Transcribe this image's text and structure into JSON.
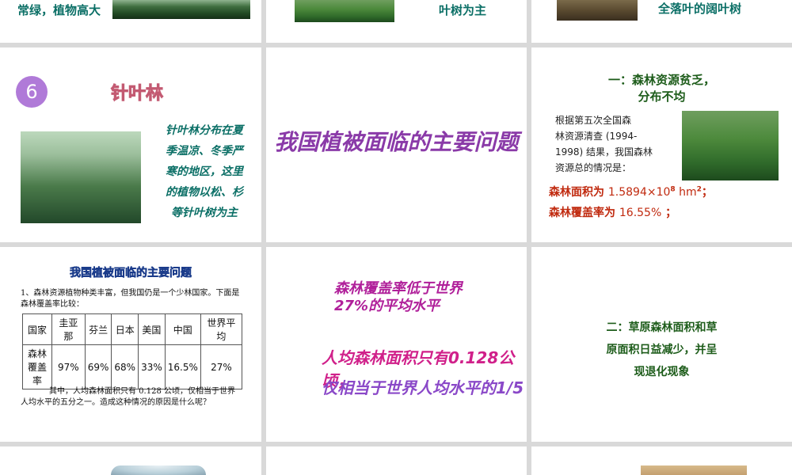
{
  "row0": {
    "left_text": "常绿，植物高大",
    "mid_text": "叶树为主",
    "right_text": "全落叶的阔叶树"
  },
  "slide_conifer": {
    "number": "6",
    "title": "针叶林",
    "body": [
      "针叶林分布在夏",
      "季温凉、冬季严",
      "寒的地区，这里",
      "的植物以松、杉",
      "等针叶树为主"
    ]
  },
  "slide_problem": {
    "heading": "我国植被面临的主要问题"
  },
  "slide_forest_shortage": {
    "heading_line1": "一：森林资源贫乏，",
    "heading_line2": "分布不均",
    "body": [
      "根据第五次全国森",
      "林资源清查 (1994-",
      "1998) 结果，我国森林",
      "资源总的情况是："
    ],
    "area_label": "森林面积为",
    "area_value": "1.5894×10",
    "area_exp": "8",
    "area_unit": " hm",
    "area_unit_exp": "2",
    "area_end": "；",
    "coverage_label": "森林覆盖率为",
    "coverage_value": "16.55%",
    "coverage_end": "；"
  },
  "slide_table": {
    "heading": "我国植被面临的主要问题",
    "intro": "1、森林资源植物种类丰富，但我国仍是一个少林国家。下面是森林覆盖率比较：",
    "headers": [
      "国家",
      "圭亚那",
      "芬兰",
      "日本",
      "美国",
      "中国",
      "世界平均"
    ],
    "row_label": "森林覆盖率",
    "values": [
      "97%",
      "69%",
      "68%",
      "33%",
      "16.5%",
      "27%"
    ],
    "outro": "其中，人均森林面积只有 0.128 公顷，仅相当于世界人均水平的五分之一。造成这种情况的原因是什么呢？"
  },
  "slide_coverage": {
    "line1": "森林覆盖率低于世界",
    "line2": "27%的平均水平",
    "line3": "人均森林面积只有0.128公顷，",
    "line4": "仅相当于世界人均水平的1/5"
  },
  "slide_grassland": {
    "line1": "二：草原森林面积和草",
    "line2": "原面积日益减少，并呈",
    "line3": "现退化现象"
  }
}
